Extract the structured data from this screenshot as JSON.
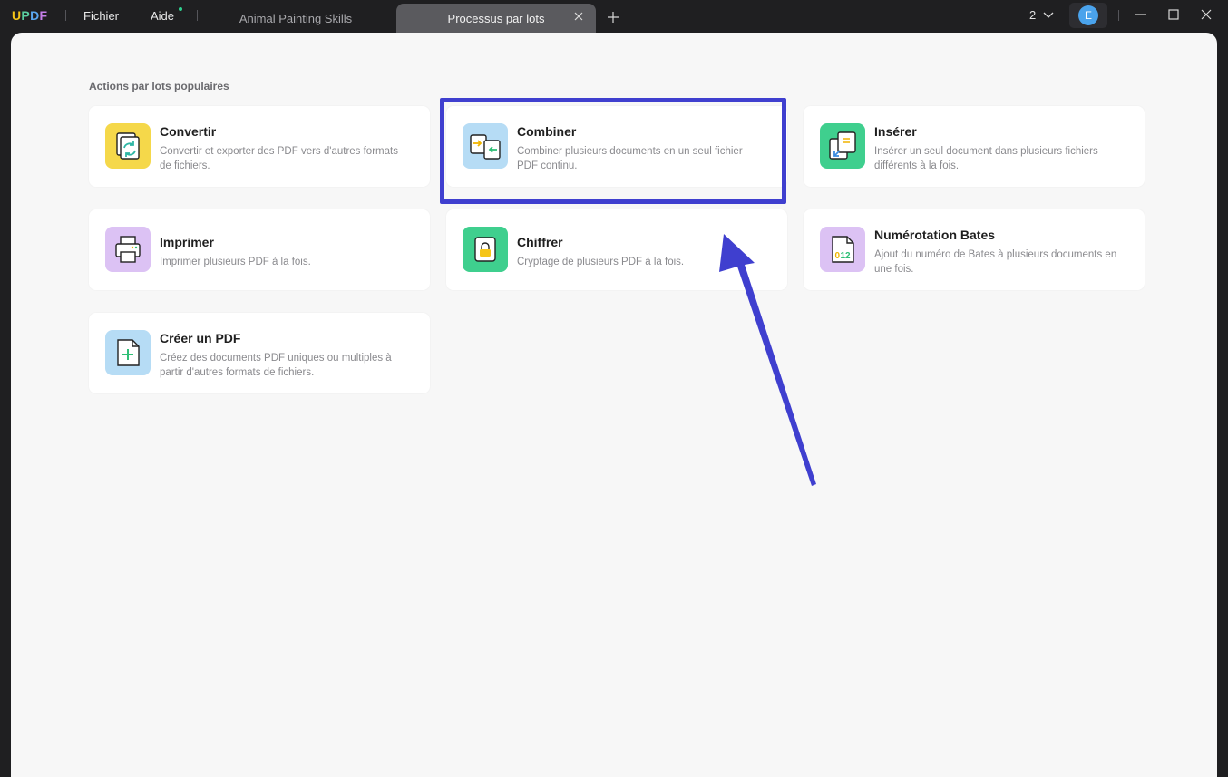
{
  "app": {
    "logo": {
      "u": "U",
      "p": "P",
      "d": "D",
      "f": "F"
    },
    "menu": {
      "file": "Fichier",
      "help": "Aide"
    },
    "tabs": [
      {
        "label": "Animal Painting Skills",
        "active": false
      },
      {
        "label": "Processus par lots",
        "active": true
      }
    ],
    "counter": "2",
    "avatar_initial": "E"
  },
  "colors": {
    "accent": "#3f3fcf",
    "yellow": "#f5d84a",
    "blue_light": "#b6dcf5",
    "green": "#3fcf8e",
    "purple_light": "#dcc2f4"
  },
  "batch": {
    "section_title": "Actions par lots populaires",
    "actions": [
      {
        "title": "Convertir",
        "desc": "Convertir et exporter des PDF vers d'autres formats de fichiers.",
        "icon": "convert-icon"
      },
      {
        "title": "Combiner",
        "desc": "Combiner plusieurs documents en un seul fichier PDF continu.",
        "icon": "combine-icon"
      },
      {
        "title": "Insérer",
        "desc": "Insérer un seul document dans plusieurs fichiers différents à la fois.",
        "icon": "insert-icon"
      },
      {
        "title": "Imprimer",
        "desc": "Imprimer plusieurs PDF à la fois.",
        "icon": "print-icon"
      },
      {
        "title": "Chiffrer",
        "desc": "Cryptage de plusieurs PDF à la fois.",
        "icon": "lock-icon"
      },
      {
        "title": "Numérotation Bates",
        "desc": "Ajout du numéro de Bates à plusieurs documents en une fois.",
        "icon": "bates-icon"
      },
      {
        "title": "Créer un PDF",
        "desc": "Créez des documents PDF uniques ou multiples à partir d'autres formats de fichiers.",
        "icon": "create-pdf-icon"
      }
    ]
  }
}
